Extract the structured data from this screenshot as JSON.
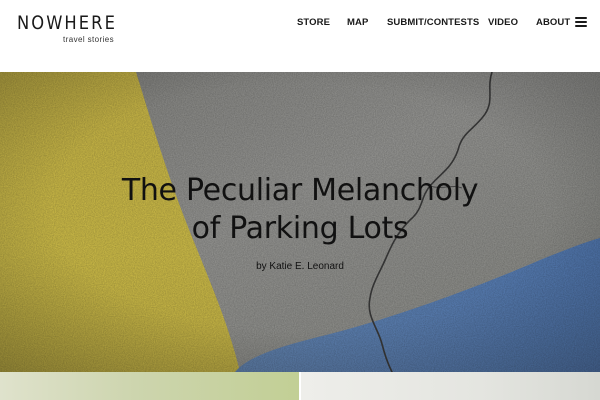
{
  "site": {
    "logo_name": "NOWHERE",
    "logo_tagline": "travel stories"
  },
  "nav": {
    "items": [
      "STORE",
      "MAP",
      "SUBMIT/CONTESTS",
      "VIDEO",
      "ABOUT"
    ],
    "menu_icon": "hamburger-menu-icon"
  },
  "hero": {
    "title_line1": "The Peculiar Melancholy",
    "title_line2": "of Parking Lots",
    "byline": "by Katie E. Leonard",
    "image_colors": {
      "yellow_paint": "#cbb83a",
      "asphalt": "#8a8a86",
      "blue_paint": "#4f79b4"
    }
  },
  "tiles": {
    "left_color": "#cdd5ae",
    "right_color": "#e4e5e0"
  }
}
